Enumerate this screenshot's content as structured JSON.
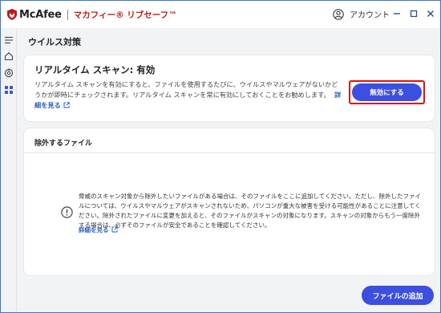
{
  "app": {
    "brand": "McAfee",
    "product": "マカフィー® リブセーフ™",
    "account_label": "アカウント"
  },
  "window_controls": [
    "help-icon",
    "minimize-icon",
    "maximize-icon",
    "close-icon"
  ],
  "sidebar": {
    "items": [
      {
        "icon": "menu-icon"
      },
      {
        "icon": "home-icon"
      },
      {
        "icon": "protection-icon"
      },
      {
        "icon": "apps-grid-icon"
      }
    ]
  },
  "page": {
    "title": "ウイルス対策"
  },
  "realtime": {
    "title": "リアルタイム スキャン: 有効",
    "description": "リアルタイム スキャンを有効にすると、ファイルを使用するたびに、ウイルスやマルウェアがないかどうかが即時にチェックされます。リアルタイム スキャンを常に有効にしておくことをお勧めします。",
    "link": "詳細を見る",
    "button": "無効にする"
  },
  "exclusions": {
    "header": "除外するファイル",
    "text": "脅威のスキャン対象から除外したいファイルがある場合は、そのファイルをここに追加してください。ただし、除外したファイルについては、ウイルスやマルウェアがスキャンされないため、パソコンが重大な被害を受ける可能性があることに注意してください。除外されたファイルに変更を加えると、そのファイルがスキャンの対象になります。スキャンの対象からもう一度除外する場合は、必ずそのファイルが安全であることを確認してください。",
    "link": "詳細を見る",
    "add_button": "ファイルの追加"
  },
  "colors": {
    "accent": "#3d4fe0",
    "brand_red": "#c01818",
    "highlight": "#e01010"
  }
}
